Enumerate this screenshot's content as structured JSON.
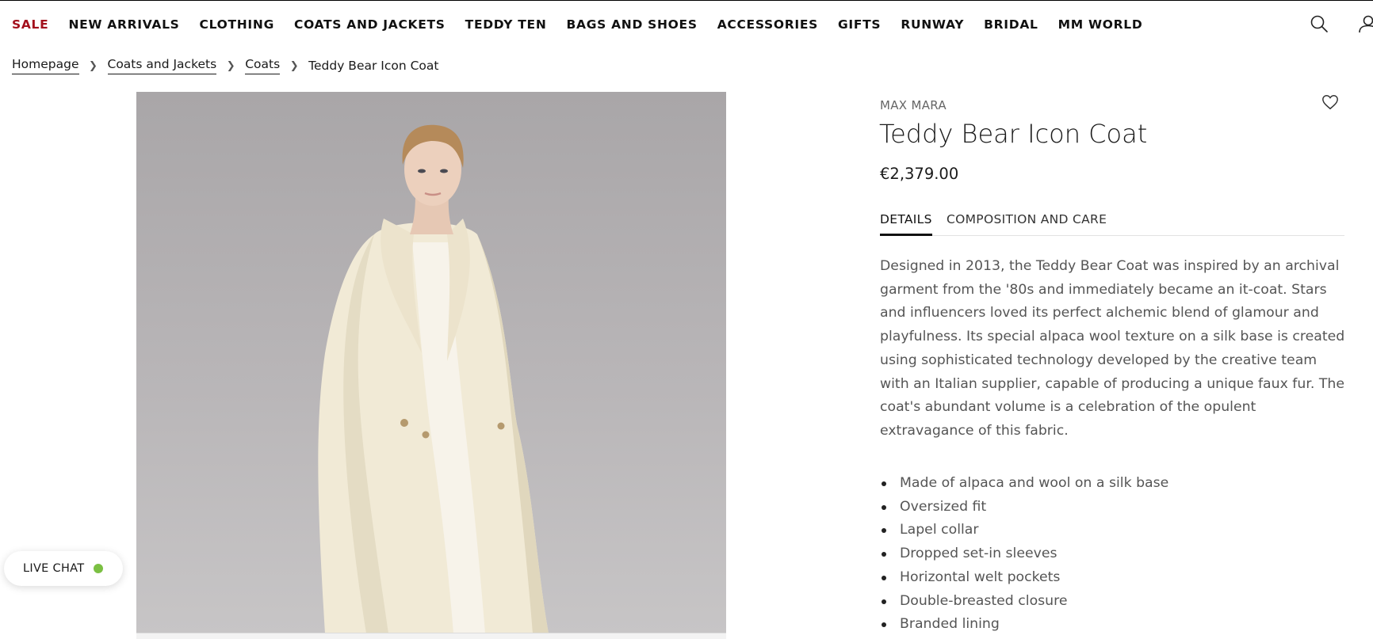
{
  "nav": {
    "items": [
      {
        "label": "SALE",
        "key": "sale"
      },
      {
        "label": "NEW ARRIVALS",
        "key": "new-arrivals"
      },
      {
        "label": "CLOTHING",
        "key": "clothing"
      },
      {
        "label": "COATS AND JACKETS",
        "key": "coats-and-jackets"
      },
      {
        "label": "TEDDY TEN",
        "key": "teddy-ten"
      },
      {
        "label": "BAGS AND SHOES",
        "key": "bags-and-shoes"
      },
      {
        "label": "ACCESSORIES",
        "key": "accessories"
      },
      {
        "label": "GIFTS",
        "key": "gifts"
      },
      {
        "label": "RUNWAY",
        "key": "runway"
      },
      {
        "label": "BRIDAL",
        "key": "bridal"
      },
      {
        "label": "MM WORLD",
        "key": "mm-world"
      }
    ],
    "sale_color": "#a3111d"
  },
  "header_icons": {
    "search": "search-icon",
    "account": "user-icon"
  },
  "breadcrumb": {
    "links": [
      "Homepage",
      "Coats and Jackets",
      "Coats"
    ],
    "current": "Teddy Bear Icon Coat"
  },
  "product": {
    "brand": "MAX MARA",
    "title": "Teddy Bear Icon Coat",
    "price": "€2,379.00",
    "tabs": [
      "DETAILS",
      "COMPOSITION AND CARE"
    ],
    "active_tab": "DETAILS",
    "description": "Designed in 2013, the Teddy Bear Coat was inspired by an archival garment from the '80s and immediately became an it-coat. Stars and influencers loved its perfect alchemic blend of glamour and playfulness. Its special alpaca wool texture on a silk base is created using sophisticated technology developed by the creative team with an Italian supplier, capable of producing a unique faux fur. The coat's abundant volume is a celebration of the opulent extravagance of this fabric.",
    "features": [
      "Made of alpaca and wool on a silk base",
      "Oversized fit",
      "Lapel collar",
      "Dropped set-in sleeves",
      "Horizontal welt pockets",
      "Double-breasted closure",
      "Branded lining"
    ],
    "wishlist_icon": "heart-icon"
  },
  "live_chat": {
    "label": "LIVE CHAT",
    "status_color": "#7bc043"
  }
}
